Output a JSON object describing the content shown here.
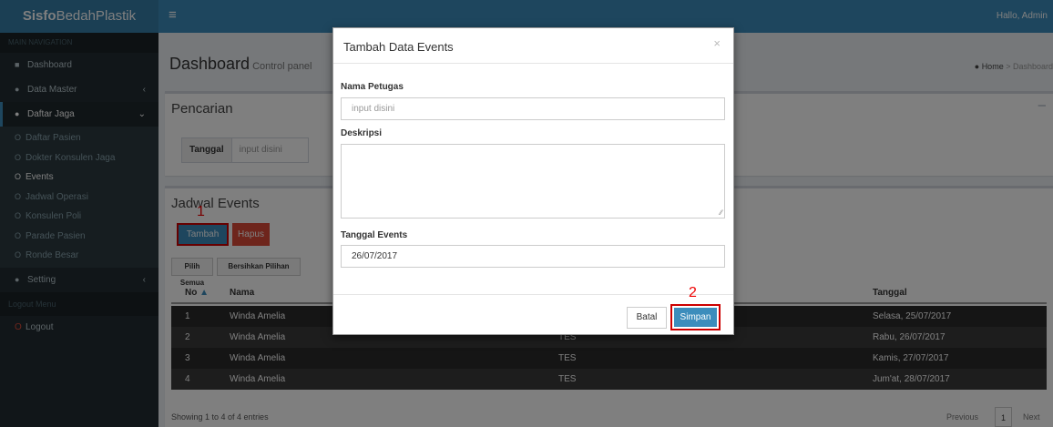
{
  "app": {
    "logo_bold": "Sisfo",
    "logo_rest": "BedahPlastik",
    "menu_icon": "≡",
    "greeting": "Hallo, Admin"
  },
  "sidebar": {
    "header": "MAIN NAVIGATION",
    "items": [
      {
        "label": "Dashboard"
      },
      {
        "label": "Data Master"
      },
      {
        "label": "Daftar Jaga"
      }
    ],
    "sub_items": [
      {
        "label": "Daftar Pasien"
      },
      {
        "label": "Dokter Konsulen Jaga"
      },
      {
        "label": "Events"
      },
      {
        "label": "Jadwal Operasi"
      },
      {
        "label": "Konsulen Poli"
      },
      {
        "label": "Parade Pasien"
      },
      {
        "label": "Ronde Besar"
      }
    ],
    "setting": "Setting",
    "separator": "Logout Menu",
    "logout": "Logout"
  },
  "page": {
    "title": "Dashboard",
    "subtitle": "Control panel",
    "breadcrumb_home": "Home",
    "breadcrumb_current": "Dashboard"
  },
  "search_box": {
    "title": "Pencarian",
    "date_label": "Tanggal",
    "date_placeholder": "input disini"
  },
  "events_box": {
    "title": "Jadwal Events",
    "add_label": "Tambah",
    "delete_label": "Hapus",
    "select_all": "Pilih Semua",
    "clear_selection": "Bersihkan Pilihan",
    "annotation_1": "1",
    "columns": [
      "No",
      "Nama",
      "Tanggal"
    ],
    "rows": [
      {
        "no": "1",
        "nama": "Winda Amelia",
        "desc": "",
        "tanggal": "Selasa, 25/07/2017"
      },
      {
        "no": "2",
        "nama": "Winda Amelia",
        "desc": "TES",
        "tanggal": "Rabu, 26/07/2017"
      },
      {
        "no": "3",
        "nama": "Winda Amelia",
        "desc": "TES",
        "tanggal": "Kamis, 27/07/2017"
      },
      {
        "no": "4",
        "nama": "Winda Amelia",
        "desc": "TES",
        "tanggal": "Jum'at, 28/07/2017"
      }
    ],
    "info": "Showing 1 to 4 of 4 entries",
    "prev": "Previous",
    "page": "1",
    "next": "Next"
  },
  "modal": {
    "title": "Tambah Data Events",
    "close": "×",
    "petugas_label": "Nama Petugas",
    "petugas_placeholder": "input disini",
    "deskripsi_label": "Deskripsi",
    "tanggal_label": "Tanggal Events",
    "tanggal_value": "26/07/2017",
    "cancel": "Batal",
    "save": "Simpan",
    "annotation_2": "2"
  },
  "colors": {
    "primary": "#3c8dbc",
    "danger": "#dd4b39",
    "sidebar": "#222d32",
    "annotation": "#cc0000"
  }
}
